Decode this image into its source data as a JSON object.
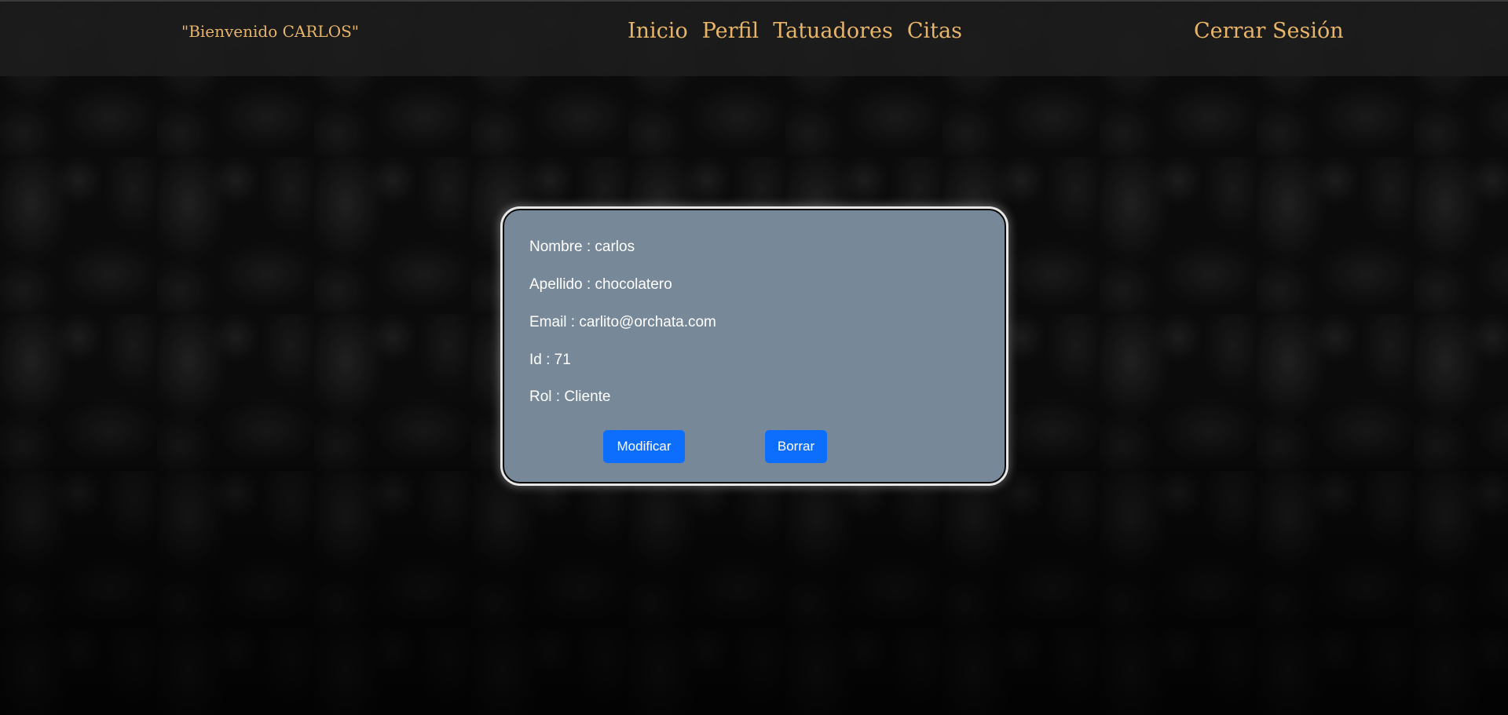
{
  "header": {
    "welcome": "\"Bienvenido CARLOS\"",
    "nav": [
      "Inicio",
      "Perfil",
      "Tatuadores",
      "Citas"
    ],
    "logout": "Cerrar Sesión"
  },
  "profile": {
    "nombre": "Nombre : carlos",
    "apellido": "Apellido : chocolatero",
    "email": "Email : carlito@orchata.com",
    "id": "Id : 71",
    "rol": "Rol : Cliente",
    "modify_label": "Modificar",
    "delete_label": "Borrar"
  },
  "colors": {
    "accent_text": "#e7b56a",
    "card_background": "#778898",
    "button_primary": "#0d6efd"
  }
}
